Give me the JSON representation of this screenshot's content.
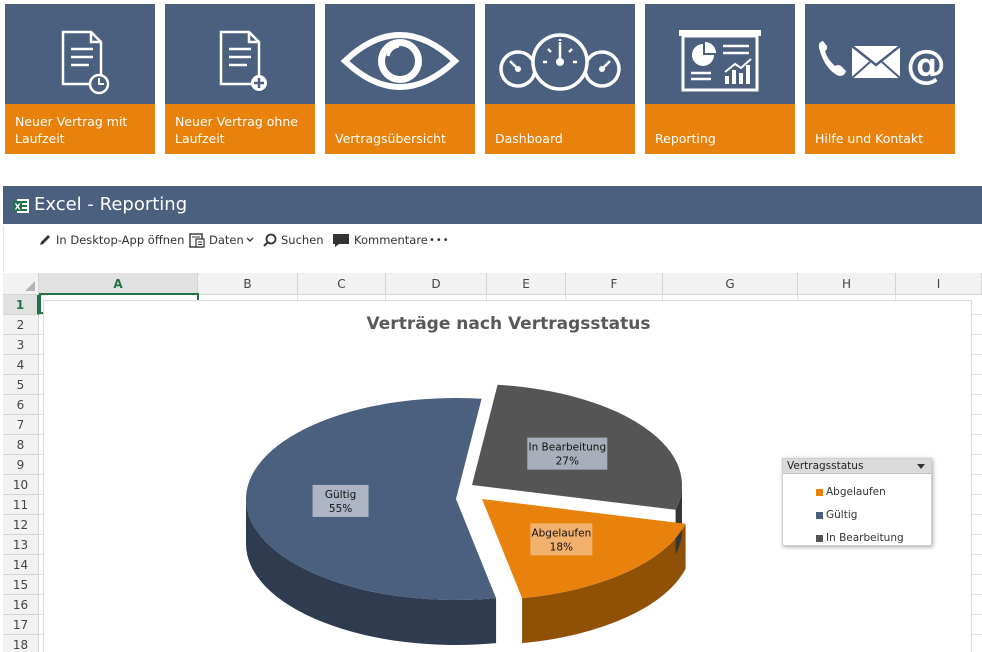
{
  "tiles": [
    {
      "label": "Neuer Vertrag mit Laufzeit",
      "icon": "document-clock-icon"
    },
    {
      "label": "Neuer Vertrag ohne Laufzeit",
      "icon": "document-plus-icon"
    },
    {
      "label": "Vertragsübersicht",
      "icon": "eye-icon"
    },
    {
      "label": "Dashboard",
      "icon": "gauges-icon"
    },
    {
      "label": "Reporting",
      "icon": "presentation-chart-icon"
    },
    {
      "label": "Hilfe und Kontakt",
      "icon": "phone-mail-at-icon"
    }
  ],
  "excel": {
    "title": "Excel - Reporting"
  },
  "toolbar": {
    "open_desktop": "In Desktop-App öffnen",
    "data": "Daten",
    "search": "Suchen",
    "comments": "Kommentare",
    "more": "•••"
  },
  "sheet": {
    "columns": [
      "A",
      "B",
      "C",
      "D",
      "E",
      "F",
      "G",
      "H",
      "I"
    ],
    "selected_column": "A",
    "rows": [
      "1",
      "2",
      "3",
      "4",
      "5",
      "6",
      "7",
      "8",
      "9",
      "10",
      "11",
      "12",
      "13",
      "14",
      "15",
      "16",
      "17",
      "18"
    ],
    "selected_row": "1"
  },
  "chart_data": {
    "type": "pie",
    "title": "Verträge nach Vertragsstatus",
    "slices": [
      {
        "name": "Gültig",
        "value": 55,
        "label": "55%",
        "color": "#4b5f7f"
      },
      {
        "name": "In Bearbeitung",
        "value": 27,
        "label": "27%",
        "color": "#555555"
      },
      {
        "name": "Abgelaufen",
        "value": 18,
        "label": "18%",
        "color": "#e8820c"
      }
    ],
    "legend": {
      "title": "Vertragsstatus",
      "position": "right",
      "items": [
        {
          "name": "Abgelaufen",
          "color": "#e8820c"
        },
        {
          "name": "Gültig",
          "color": "#4b5f7f"
        },
        {
          "name": "In Bearbeitung",
          "color": "#555555"
        }
      ]
    }
  },
  "colors": {
    "tile_blue": "#4b5f7f",
    "tile_orange": "#e8820c",
    "excel_green": "#217346"
  }
}
